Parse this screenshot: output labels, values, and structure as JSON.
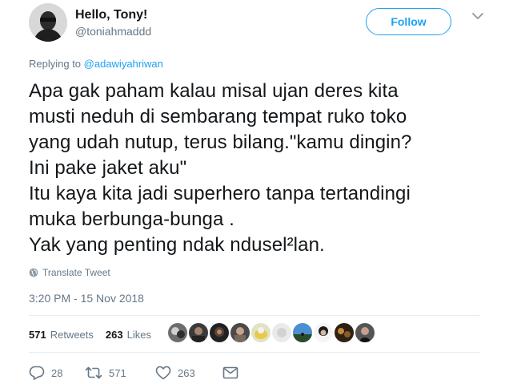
{
  "user": {
    "display_name": "Hello, Tony!",
    "handle": "@toniahmaddd"
  },
  "follow_label": "Follow",
  "replying": {
    "prefix": "Replying to ",
    "to": "@adawiyahriwan"
  },
  "tweet_text": "Apa gak paham kalau misal ujan deres kita\nmusti neduh di sembarang tempat ruko toko\nyang udah nutup, terus bilang.\"kamu dingin?\nIni pake jaket aku\"\nItu kaya kita jadi superhero tanpa tertandingi\nmuka berbunga-bunga .\nYak yang penting ndak ndusel²lan.",
  "translate_label": "Translate Tweet",
  "timestamp": "3:20 PM - 15 Nov 2018",
  "stats": {
    "retweets_count": "571",
    "retweets_label": "Retweets",
    "likes_count": "263",
    "likes_label": "Likes"
  },
  "actions": {
    "replies": "28",
    "retweets": "571",
    "likes": "263"
  },
  "colors": {
    "accent": "#1da1f2",
    "muted": "#657786",
    "text": "#14171a"
  },
  "icons": {
    "more": "chevron-down-icon",
    "translate": "globe-icon",
    "reply": "reply-icon",
    "retweet": "retweet-icon",
    "like": "heart-icon",
    "dm": "envelope-icon"
  }
}
